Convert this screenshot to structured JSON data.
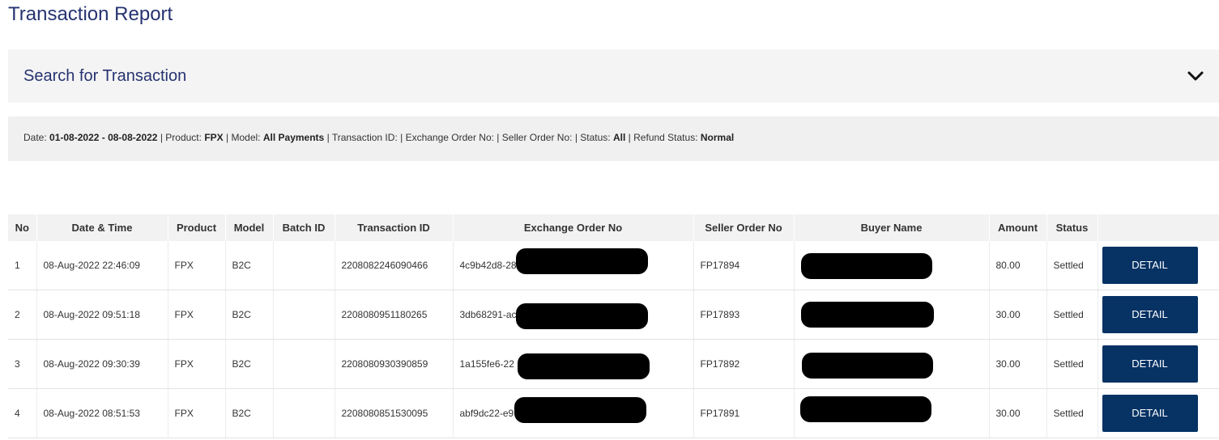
{
  "page": {
    "title": "Transaction Report"
  },
  "search": {
    "title": "Search for Transaction"
  },
  "filters": {
    "date_label": "Date:",
    "date_value": "01-08-2022 - 08-08-2022",
    "product_label": "Product:",
    "product_value": "FPX",
    "model_label": "Model:",
    "model_value": "All Payments",
    "transaction_id_label": "Transaction ID:",
    "exchange_order_label": "Exchange Order No:",
    "seller_order_label": "Seller Order No:",
    "status_label": "Status:",
    "status_value": "All",
    "refund_label": "Refund Status:",
    "refund_value": "Normal",
    "separator": "|"
  },
  "table": {
    "headers": [
      "No",
      "Date & Time",
      "Product",
      "Model",
      "Batch ID",
      "Transaction ID",
      "Exchange Order No",
      "Seller Order No",
      "Buyer Name",
      "Amount",
      "Status",
      ""
    ],
    "rows": [
      {
        "no": "1",
        "datetime": "08-Aug-2022 22:46:09",
        "product": "FPX",
        "model": "B2C",
        "batch_id": "",
        "transaction_id": "2208082246090466",
        "exchange_order": "4c9b42d8-28",
        "seller_order": "FP17894",
        "buyer_name": "",
        "amount": "80.00",
        "status": "Settled",
        "action": "DETAIL"
      },
      {
        "no": "2",
        "datetime": "08-Aug-2022 09:51:18",
        "product": "FPX",
        "model": "B2C",
        "batch_id": "",
        "transaction_id": "2208080951180265",
        "exchange_order": "3db68291-ac",
        "seller_order": "FP17893",
        "buyer_name": "",
        "amount": "30.00",
        "status": "Settled",
        "action": "DETAIL"
      },
      {
        "no": "3",
        "datetime": "08-Aug-2022 09:30:39",
        "product": "FPX",
        "model": "B2C",
        "batch_id": "",
        "transaction_id": "2208080930390859",
        "exchange_order": "1a155fe6-22",
        "seller_order": "FP17892",
        "buyer_name": "",
        "amount": "30.00",
        "status": "Settled",
        "action": "DETAIL"
      },
      {
        "no": "4",
        "datetime": "08-Aug-2022 08:51:53",
        "product": "FPX",
        "model": "B2C",
        "batch_id": "",
        "transaction_id": "2208080851530095",
        "exchange_order": "abf9dc22-e9",
        "seller_order": "FP17891",
        "buyer_name": "",
        "amount": "30.00",
        "status": "Settled",
        "action": "DETAIL"
      }
    ]
  },
  "colors": {
    "title": "#263370",
    "button": "#063264",
    "panel": "#f4f4f4"
  },
  "icons": {
    "search_toggle": "chevron-down-icon"
  }
}
